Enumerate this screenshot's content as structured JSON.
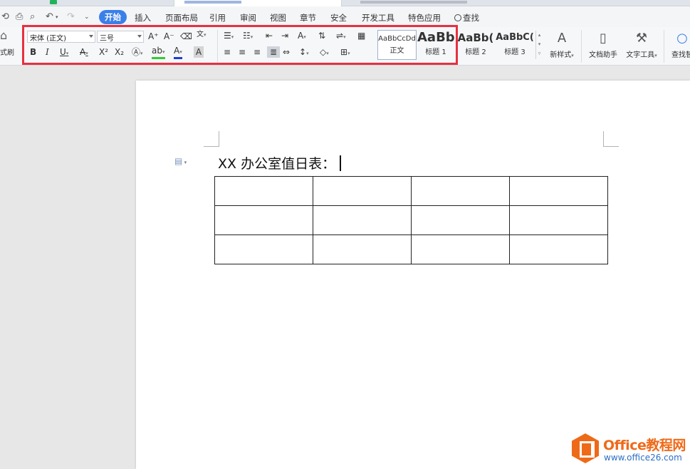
{
  "menu": {
    "items": [
      "开始",
      "插入",
      "页面布局",
      "引用",
      "审阅",
      "视图",
      "章节",
      "安全",
      "开发工具",
      "特色应用"
    ],
    "search_label": "查找"
  },
  "ribbon": {
    "format_painter_label": "式刷",
    "font_name": "宋体 (正文)",
    "font_size": "三号",
    "styles": [
      {
        "sample": "AaBbCcDd",
        "name": "正文"
      },
      {
        "sample": "AaBb",
        "name": "标题 1"
      },
      {
        "sample": "AaBb(",
        "name": "标题 2"
      },
      {
        "sample": "AaBbC(",
        "name": "标题 3"
      }
    ],
    "new_style_label": "新样式",
    "doc_helper_label": "文档助手",
    "text_tools_label": "文字工具",
    "find_replace_label": "查找替"
  },
  "document": {
    "title": "XX 办公室值日表：",
    "table": {
      "rows": 3,
      "cols": 4
    }
  },
  "watermark": {
    "brand": "Office教程网",
    "url": "www.office26.com"
  },
  "colors": {
    "accent": "#3b80e8",
    "highlight_border": "#e7303f",
    "watermark_orange": "#ef6a18",
    "watermark_blue": "#2e6fc6"
  }
}
